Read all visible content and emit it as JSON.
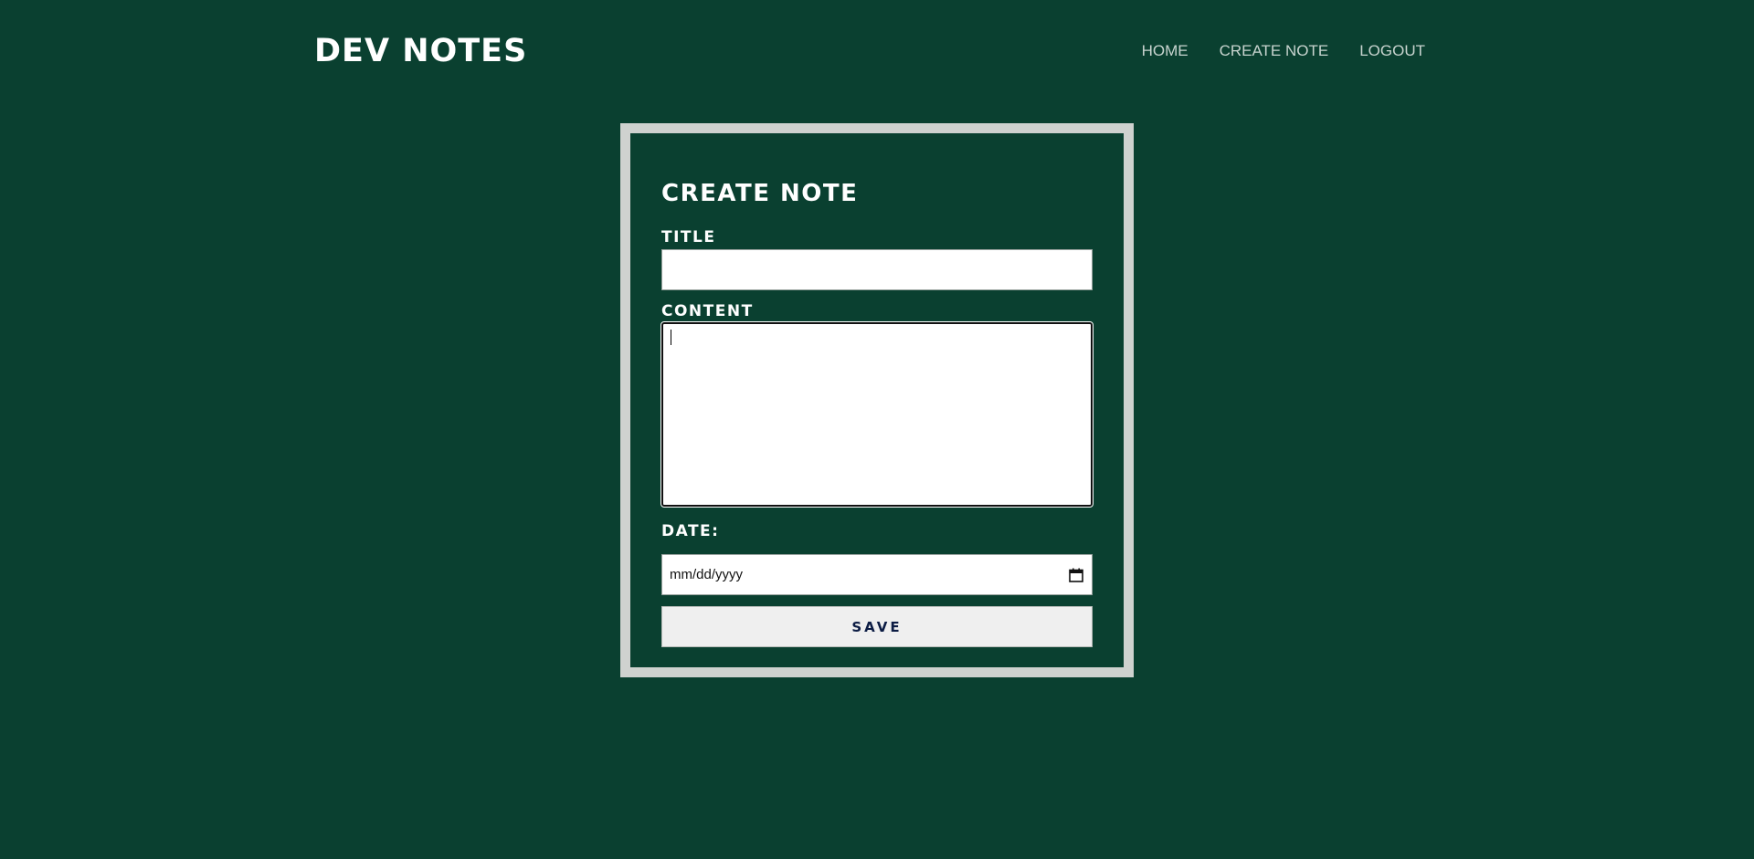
{
  "header": {
    "logo": "DEV NOTES",
    "nav": {
      "home": "HOME",
      "create_note": "CREATE NOTE",
      "logout": "LOGOUT"
    }
  },
  "form": {
    "title": "CREATE NOTE",
    "title_label": "TITLE",
    "title_value": "",
    "content_label": "CONTENT",
    "content_value": "",
    "date_label": "DATE:",
    "date_placeholder": "mm/dd/yyyy",
    "save_label": "SAVE"
  },
  "colors": {
    "background": "#0a4030",
    "card_border": "#cfd2cf",
    "button_text": "#0c1c44"
  },
  "icons": {
    "date_picker": "calendar-icon"
  }
}
